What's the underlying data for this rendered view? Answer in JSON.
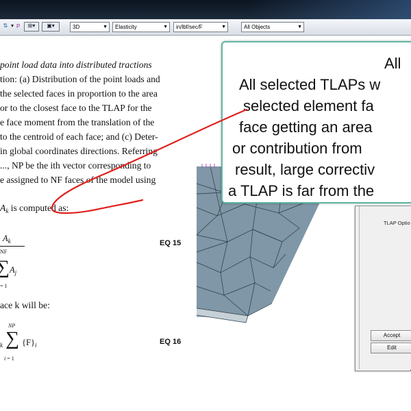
{
  "toolbar": {
    "view_select": "3D",
    "analysis_select": "Elasticity",
    "units_select": "in/lbf/sec/F",
    "filter_select": "All Objects",
    "small_p": "P"
  },
  "document": {
    "lines": [
      "point load data into distributed tractions",
      "tion: (a) Distribution of the point loads and",
      "the selected faces in proportion to the area",
      "or to the closest face to the TLAP for the",
      "e face moment from the translation of the",
      "to the centroid of each face; and (c) Deter-",
      "in global coordinates directions. Referring",
      "..., NP be the ith vector corresponding to",
      "e assigned to NF faces of the model using"
    ],
    "computed_line": " is computed as:",
    "a_k": "A",
    "k": "k",
    "nf": "NF",
    "a_j": "A",
    "j": "j",
    "i_eq_1": "= 1",
    "face_line": "ace k will be:",
    "np": "NP",
    "f_vec": "{F}",
    "i": "i",
    "eq15": "EQ 15",
    "eq16": "EQ 16"
  },
  "dialog": {
    "tlap_label": "TLAP Optio",
    "accept_label": "Accept",
    "edit_label": "Edit"
  },
  "callout": {
    "lines": [
      "All",
      "All selected TLAPs w",
      "selected element fa",
      "face getting an area",
      "or contribution from",
      "result, large correctiv",
      "a TLAP is far from the"
    ]
  },
  "colors": {
    "callout_border": "#5fb8a3",
    "annotation_red": "#e0201c",
    "mesh_face": "#7c93a2",
    "mesh_edge": "#2a3a46"
  }
}
